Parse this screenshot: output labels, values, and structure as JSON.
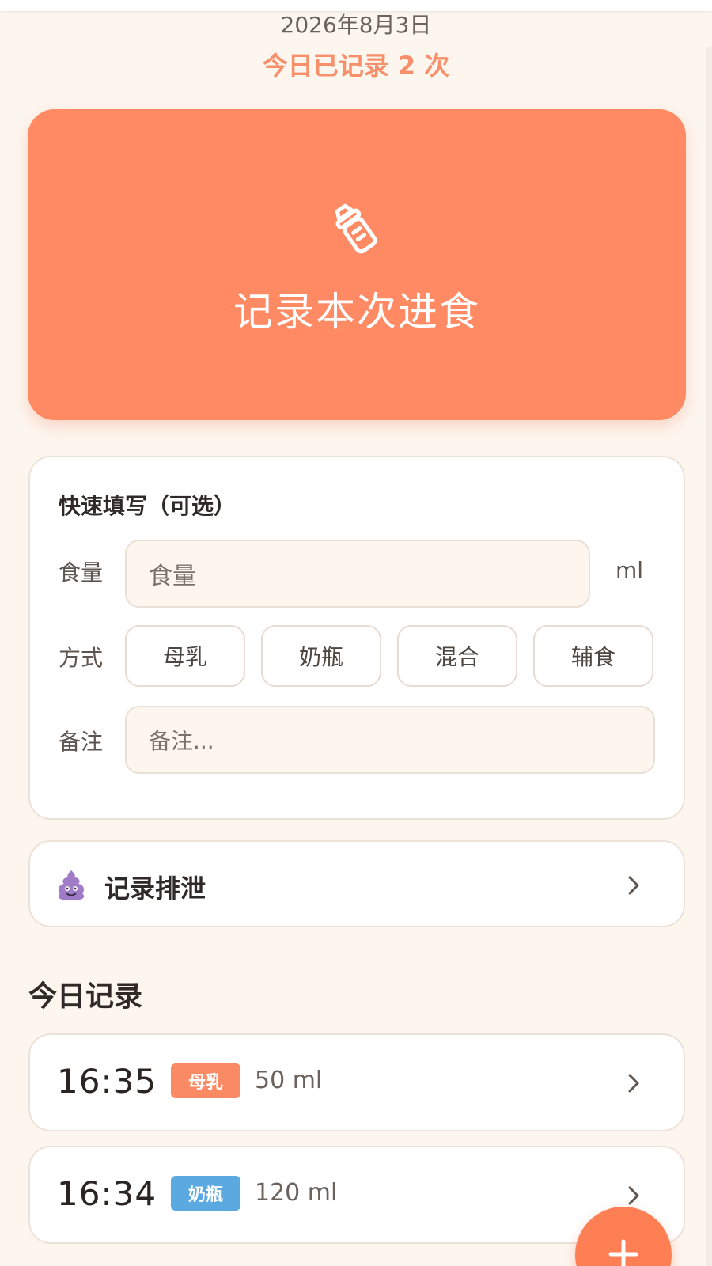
{
  "header": {
    "date": "2026年8月3日",
    "today_count": "今日已记录 2 次"
  },
  "hero": {
    "icon": "baby-bottle-icon",
    "title": "记录本次进食",
    "color": "#ff8a63"
  },
  "quick_fill": {
    "title": "快速填写（可选）",
    "amount_label": "食量",
    "amount_placeholder": "食量",
    "amount_unit": "ml",
    "method_label": "方式",
    "methods": [
      "母乳",
      "奶瓶",
      "混合",
      "辅食"
    ],
    "note_label": "备注",
    "note_placeholder": "备注..."
  },
  "excretion": {
    "icon": "poop-icon",
    "label": "记录排泄"
  },
  "today_records": {
    "title": "今日记录",
    "items": [
      {
        "time": "16:35",
        "type": "母乳",
        "type_color": "#f98a63",
        "amount": "50 ml"
      },
      {
        "time": "16:34",
        "type": "奶瓶",
        "type_color": "#5aa9e0",
        "amount": "120 ml"
      }
    ]
  },
  "fab": {
    "icon": "plus-icon"
  }
}
